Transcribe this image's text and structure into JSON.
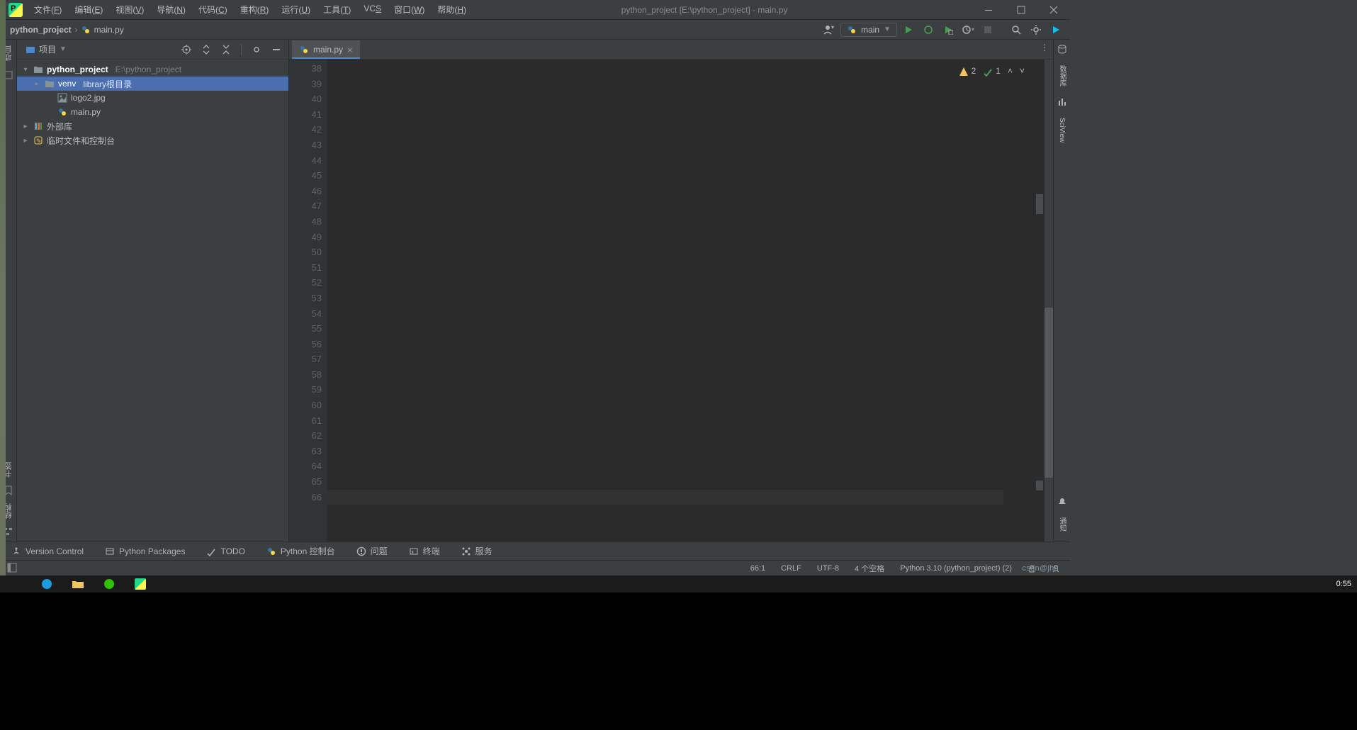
{
  "window": {
    "title": "python_project [E:\\python_project] - main.py"
  },
  "menu": [
    {
      "label": "文件",
      "ul": "F"
    },
    {
      "label": "编辑",
      "ul": "E"
    },
    {
      "label": "视图",
      "ul": "V"
    },
    {
      "label": "导航",
      "ul": "N"
    },
    {
      "label": "代码",
      "ul": "C"
    },
    {
      "label": "重构",
      "ul": "R"
    },
    {
      "label": "运行",
      "ul": "U"
    },
    {
      "label": "工具",
      "ul": "T"
    },
    {
      "label": "VCS",
      "ul": "S"
    },
    {
      "label": "窗口",
      "ul": "W"
    },
    {
      "label": "帮助",
      "ul": "H"
    }
  ],
  "breadcrumbs": [
    {
      "label": "python_project"
    },
    {
      "label": "main.py"
    }
  ],
  "run_config": {
    "label": "main"
  },
  "project_pane": {
    "title": "项目",
    "tree": {
      "root": {
        "name": "python_project",
        "path": "E:\\python_project"
      },
      "venv": {
        "name": "venv",
        "hint": "library根目录"
      },
      "file1": {
        "name": "logo2.jpg"
      },
      "file2": {
        "name": "main.py"
      },
      "ext_libs": {
        "name": "外部库"
      },
      "scratch": {
        "name": "临时文件和控制台"
      }
    }
  },
  "left_labels": {
    "top": "项目",
    "mid1": "书签",
    "mid2": "结构"
  },
  "right_labels": {
    "top": "通知",
    "db": "数据库",
    "sci": "SciView"
  },
  "editor": {
    "tab": {
      "label": "main.py"
    },
    "first_line": 38,
    "last_line": 66,
    "current_line": 66,
    "inspections": {
      "warnings": "2",
      "checks": "1"
    }
  },
  "bottom_tools": [
    {
      "label": "Version Control"
    },
    {
      "label": "Python Packages"
    },
    {
      "label": "TODO"
    },
    {
      "label": "Python 控制台"
    },
    {
      "label": "问题"
    },
    {
      "label": "终端"
    },
    {
      "label": "服务"
    }
  ],
  "status": {
    "caret": "66:1",
    "line_sep": "CRLF",
    "encoding": "UTF-8",
    "indent": "4 个空格",
    "interpreter": "Python 3.10 (python_project) (2)"
  },
  "watermark": "csdn@jhn",
  "taskbar": {
    "clock": "0:55"
  }
}
